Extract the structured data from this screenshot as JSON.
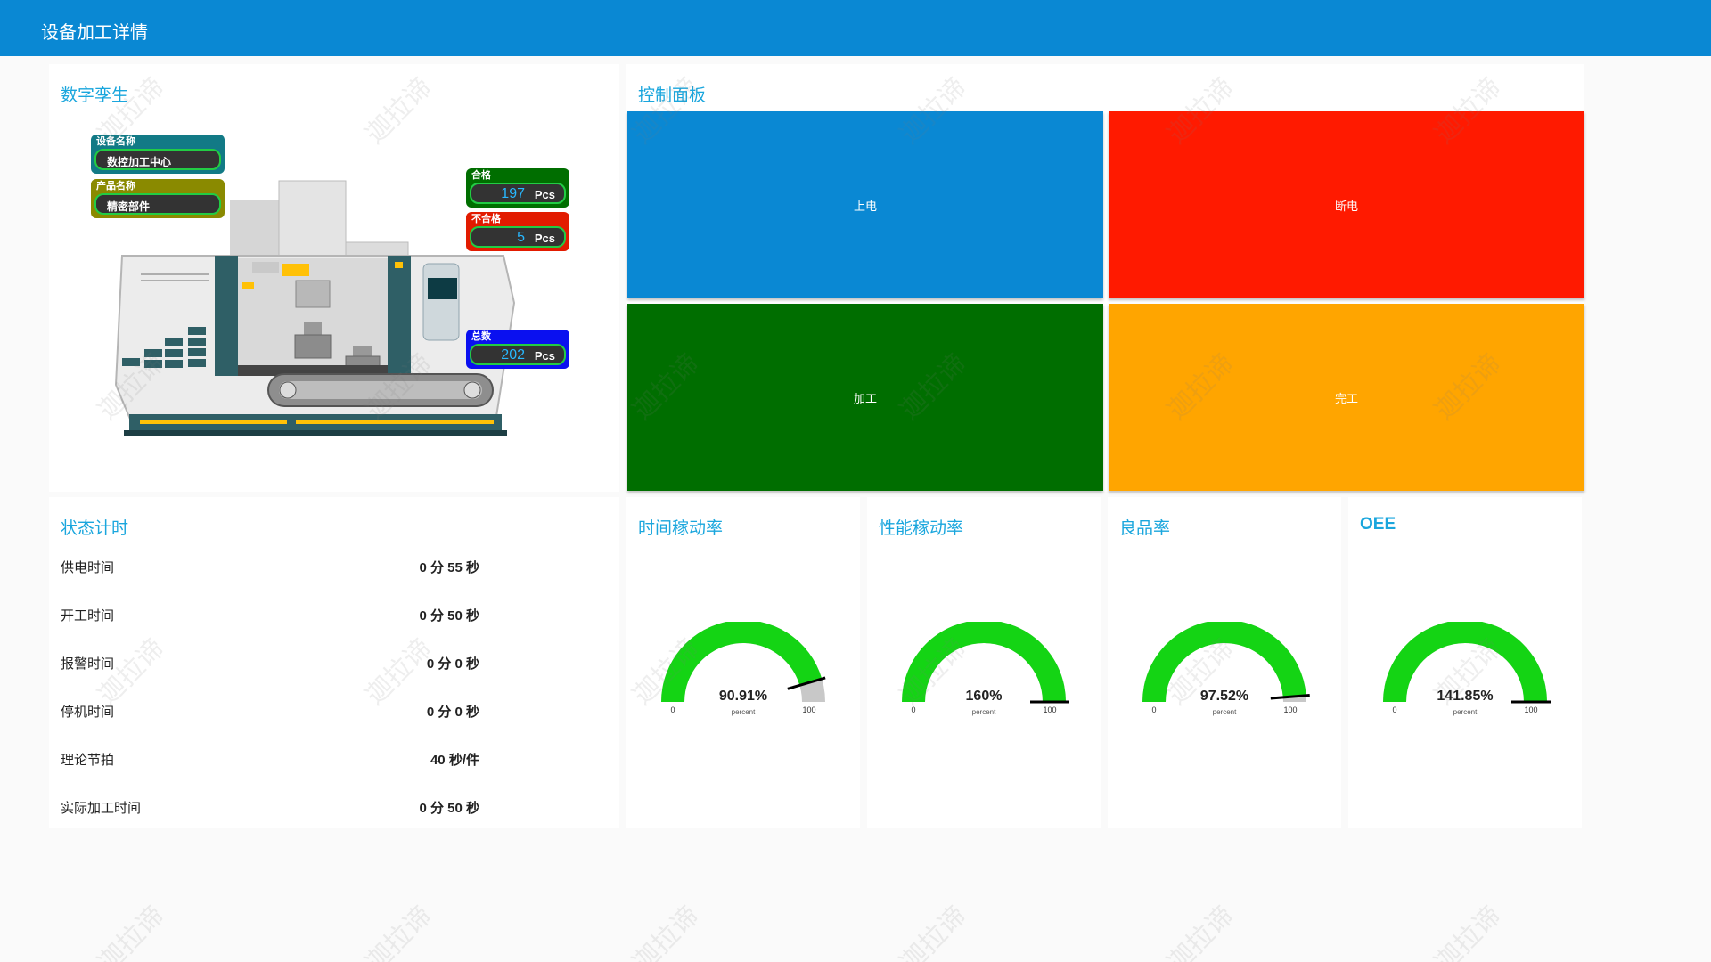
{
  "header": {
    "title": "设备加工详情"
  },
  "twin": {
    "title": "数字孪生",
    "device": {
      "label": "设备名称",
      "value": "数控加工中心"
    },
    "product": {
      "label": "产品名称",
      "value": "精密部件"
    },
    "qualified": {
      "label": "合格",
      "value": "197",
      "unit": "Pcs"
    },
    "unqualified": {
      "label": "不合格",
      "value": "5",
      "unit": "Pcs"
    },
    "total": {
      "label": "总数",
      "value": "202",
      "unit": "Pcs"
    }
  },
  "control": {
    "title": "控制面板",
    "buttons": [
      {
        "label": "上电",
        "color": "#0a88d3"
      },
      {
        "label": "断电",
        "color": "#ff1a00"
      },
      {
        "label": "加工",
        "color": "#006e00"
      },
      {
        "label": "完工",
        "color": "#ffa500"
      }
    ]
  },
  "status": {
    "title": "状态计时",
    "rows": [
      {
        "label": "供电时间",
        "value": "0 分 55 秒"
      },
      {
        "label": "开工时间",
        "value": "0 分 50 秒"
      },
      {
        "label": "报警时间",
        "value": "0 分 0 秒"
      },
      {
        "label": "停机时间",
        "value": "0 分 0 秒"
      },
      {
        "label": "理论节拍",
        "value": "40 秒/件"
      },
      {
        "label": "实际加工时间",
        "value": "0 分 50 秒"
      }
    ]
  },
  "gauges": [
    {
      "title": "时间稼动率",
      "value": 90.91,
      "display": "90.91%",
      "unit": "percent",
      "min": "0",
      "max": "100",
      "fill": "#14d414",
      "track": "#c8c8c8"
    },
    {
      "title": "性能稼动率",
      "value": 160,
      "display": "160%",
      "unit": "percent",
      "min": "0",
      "max": "100",
      "fill": "#14d414",
      "track": "#c8c8c8"
    },
    {
      "title": "良品率",
      "value": 97.52,
      "display": "97.52%",
      "unit": "percent",
      "min": "0",
      "max": "100",
      "fill": "#14d414",
      "track": "#c8c8c8"
    },
    {
      "title": "OEE",
      "value": 141.85,
      "display": "141.85%",
      "unit": "percent",
      "min": "0",
      "max": "100",
      "fill": "#14d414",
      "track": "#c8c8c8"
    }
  ],
  "watermark": "迦拉谛"
}
